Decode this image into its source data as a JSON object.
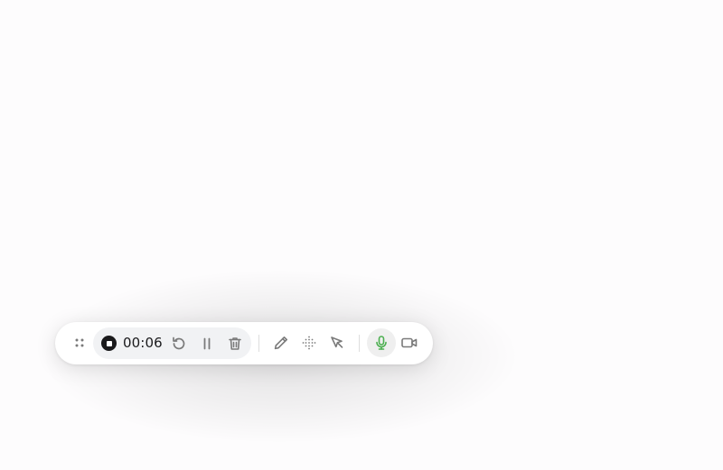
{
  "recorder": {
    "elapsed_time": "00:06",
    "icons": {
      "drag": "drag-handle-icon",
      "stop": "stop-icon",
      "restart": "restart-icon",
      "pause": "pause-icon",
      "delete": "trash-icon",
      "draw": "pencil-icon",
      "blur": "dot-grid-icon",
      "cursor": "cursor-icon",
      "microphone": "microphone-icon",
      "camera": "video-camera-icon"
    },
    "colors": {
      "mic_active": "#4caf50",
      "icon": "#7a7a7a",
      "stop": "#1a1a1c"
    }
  }
}
